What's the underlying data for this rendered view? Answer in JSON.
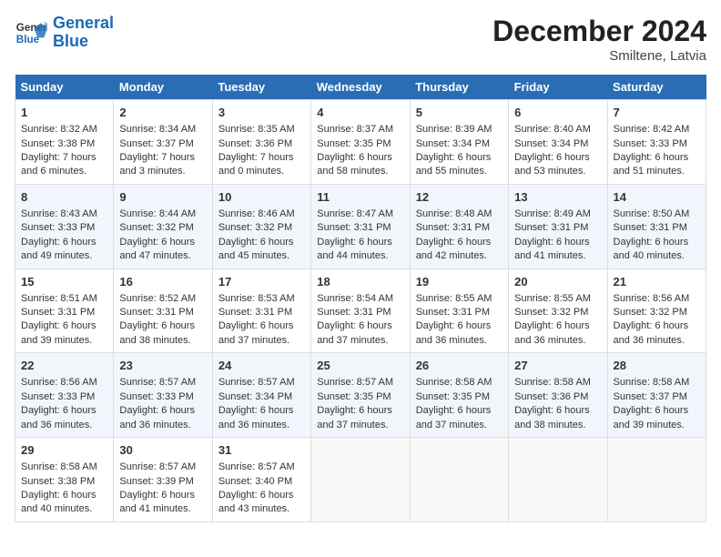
{
  "header": {
    "logo_line1": "General",
    "logo_line2": "Blue",
    "month": "December 2024",
    "location": "Smiltene, Latvia"
  },
  "days_of_week": [
    "Sunday",
    "Monday",
    "Tuesday",
    "Wednesday",
    "Thursday",
    "Friday",
    "Saturday"
  ],
  "weeks": [
    [
      {
        "day": "1",
        "sunrise": "Sunrise: 8:32 AM",
        "sunset": "Sunset: 3:38 PM",
        "daylight": "Daylight: 7 hours and 6 minutes."
      },
      {
        "day": "2",
        "sunrise": "Sunrise: 8:34 AM",
        "sunset": "Sunset: 3:37 PM",
        "daylight": "Daylight: 7 hours and 3 minutes."
      },
      {
        "day": "3",
        "sunrise": "Sunrise: 8:35 AM",
        "sunset": "Sunset: 3:36 PM",
        "daylight": "Daylight: 7 hours and 0 minutes."
      },
      {
        "day": "4",
        "sunrise": "Sunrise: 8:37 AM",
        "sunset": "Sunset: 3:35 PM",
        "daylight": "Daylight: 6 hours and 58 minutes."
      },
      {
        "day": "5",
        "sunrise": "Sunrise: 8:39 AM",
        "sunset": "Sunset: 3:34 PM",
        "daylight": "Daylight: 6 hours and 55 minutes."
      },
      {
        "day": "6",
        "sunrise": "Sunrise: 8:40 AM",
        "sunset": "Sunset: 3:34 PM",
        "daylight": "Daylight: 6 hours and 53 minutes."
      },
      {
        "day": "7",
        "sunrise": "Sunrise: 8:42 AM",
        "sunset": "Sunset: 3:33 PM",
        "daylight": "Daylight: 6 hours and 51 minutes."
      }
    ],
    [
      {
        "day": "8",
        "sunrise": "Sunrise: 8:43 AM",
        "sunset": "Sunset: 3:33 PM",
        "daylight": "Daylight: 6 hours and 49 minutes."
      },
      {
        "day": "9",
        "sunrise": "Sunrise: 8:44 AM",
        "sunset": "Sunset: 3:32 PM",
        "daylight": "Daylight: 6 hours and 47 minutes."
      },
      {
        "day": "10",
        "sunrise": "Sunrise: 8:46 AM",
        "sunset": "Sunset: 3:32 PM",
        "daylight": "Daylight: 6 hours and 45 minutes."
      },
      {
        "day": "11",
        "sunrise": "Sunrise: 8:47 AM",
        "sunset": "Sunset: 3:31 PM",
        "daylight": "Daylight: 6 hours and 44 minutes."
      },
      {
        "day": "12",
        "sunrise": "Sunrise: 8:48 AM",
        "sunset": "Sunset: 3:31 PM",
        "daylight": "Daylight: 6 hours and 42 minutes."
      },
      {
        "day": "13",
        "sunrise": "Sunrise: 8:49 AM",
        "sunset": "Sunset: 3:31 PM",
        "daylight": "Daylight: 6 hours and 41 minutes."
      },
      {
        "day": "14",
        "sunrise": "Sunrise: 8:50 AM",
        "sunset": "Sunset: 3:31 PM",
        "daylight": "Daylight: 6 hours and 40 minutes."
      }
    ],
    [
      {
        "day": "15",
        "sunrise": "Sunrise: 8:51 AM",
        "sunset": "Sunset: 3:31 PM",
        "daylight": "Daylight: 6 hours and 39 minutes."
      },
      {
        "day": "16",
        "sunrise": "Sunrise: 8:52 AM",
        "sunset": "Sunset: 3:31 PM",
        "daylight": "Daylight: 6 hours and 38 minutes."
      },
      {
        "day": "17",
        "sunrise": "Sunrise: 8:53 AM",
        "sunset": "Sunset: 3:31 PM",
        "daylight": "Daylight: 6 hours and 37 minutes."
      },
      {
        "day": "18",
        "sunrise": "Sunrise: 8:54 AM",
        "sunset": "Sunset: 3:31 PM",
        "daylight": "Daylight: 6 hours and 37 minutes."
      },
      {
        "day": "19",
        "sunrise": "Sunrise: 8:55 AM",
        "sunset": "Sunset: 3:31 PM",
        "daylight": "Daylight: 6 hours and 36 minutes."
      },
      {
        "day": "20",
        "sunrise": "Sunrise: 8:55 AM",
        "sunset": "Sunset: 3:32 PM",
        "daylight": "Daylight: 6 hours and 36 minutes."
      },
      {
        "day": "21",
        "sunrise": "Sunrise: 8:56 AM",
        "sunset": "Sunset: 3:32 PM",
        "daylight": "Daylight: 6 hours and 36 minutes."
      }
    ],
    [
      {
        "day": "22",
        "sunrise": "Sunrise: 8:56 AM",
        "sunset": "Sunset: 3:33 PM",
        "daylight": "Daylight: 6 hours and 36 minutes."
      },
      {
        "day": "23",
        "sunrise": "Sunrise: 8:57 AM",
        "sunset": "Sunset: 3:33 PM",
        "daylight": "Daylight: 6 hours and 36 minutes."
      },
      {
        "day": "24",
        "sunrise": "Sunrise: 8:57 AM",
        "sunset": "Sunset: 3:34 PM",
        "daylight": "Daylight: 6 hours and 36 minutes."
      },
      {
        "day": "25",
        "sunrise": "Sunrise: 8:57 AM",
        "sunset": "Sunset: 3:35 PM",
        "daylight": "Daylight: 6 hours and 37 minutes."
      },
      {
        "day": "26",
        "sunrise": "Sunrise: 8:58 AM",
        "sunset": "Sunset: 3:35 PM",
        "daylight": "Daylight: 6 hours and 37 minutes."
      },
      {
        "day": "27",
        "sunrise": "Sunrise: 8:58 AM",
        "sunset": "Sunset: 3:36 PM",
        "daylight": "Daylight: 6 hours and 38 minutes."
      },
      {
        "day": "28",
        "sunrise": "Sunrise: 8:58 AM",
        "sunset": "Sunset: 3:37 PM",
        "daylight": "Daylight: 6 hours and 39 minutes."
      }
    ],
    [
      {
        "day": "29",
        "sunrise": "Sunrise: 8:58 AM",
        "sunset": "Sunset: 3:38 PM",
        "daylight": "Daylight: 6 hours and 40 minutes."
      },
      {
        "day": "30",
        "sunrise": "Sunrise: 8:57 AM",
        "sunset": "Sunset: 3:39 PM",
        "daylight": "Daylight: 6 hours and 41 minutes."
      },
      {
        "day": "31",
        "sunrise": "Sunrise: 8:57 AM",
        "sunset": "Sunset: 3:40 PM",
        "daylight": "Daylight: 6 hours and 43 minutes."
      },
      null,
      null,
      null,
      null
    ]
  ]
}
